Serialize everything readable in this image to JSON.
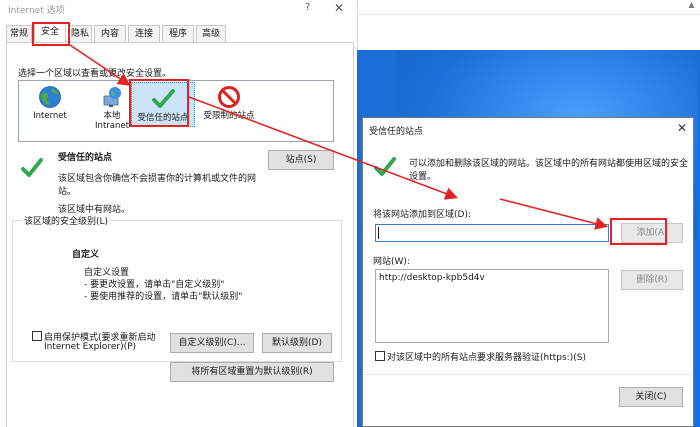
{
  "inet_dialog": {
    "title": "Internet 选项",
    "help_glyph": "?",
    "close_glyph": "✕",
    "tabs": [
      {
        "label": "常规",
        "active": false
      },
      {
        "label": "安全",
        "active": true
      },
      {
        "label": "隐私",
        "active": false
      },
      {
        "label": "内容",
        "active": false
      },
      {
        "label": "连接",
        "active": false
      },
      {
        "label": "程序",
        "active": false
      },
      {
        "label": "高级",
        "active": false
      }
    ],
    "zone_prompt": "选择一个区域以查看或更改安全设置。",
    "zones": [
      {
        "label": "Internet",
        "icon": "globe-icon"
      },
      {
        "label": "本地\nIntranet",
        "icon": "local-intranet-icon"
      },
      {
        "label": "受信任的站点",
        "icon": "checkmark-icon",
        "selected": true
      },
      {
        "label": "受限制的站点",
        "icon": "restricted-icon"
      }
    ],
    "selected_zone": {
      "title": "受信任的站点",
      "desc_line1": "该区域包含你确信不会损害你的计算机或文件的网",
      "desc_line2": "站。",
      "desc_line3": "该区域中有网站。"
    },
    "sites_button": "站点(S)",
    "security_level": {
      "legend": "该区域的安全级别(L)",
      "name": "自定义",
      "line1": "自定义设置",
      "line2": "- 要更改设置，请单击\"自定义级别\"",
      "line3": "- 要使用推荐的设置，请单击\"默认级别\""
    },
    "protected_mode": {
      "line1": "启用保护模式(要求重新启动",
      "line2": "Internet Explorer)(P)",
      "checked": false
    },
    "custom_level_button": "自定义级别(C)...",
    "default_level_button": "默认级别(D)",
    "reset_all_button": "将所有区域重置为默认级别(R)"
  },
  "trusted_dialog": {
    "title": "受信任的站点",
    "close_glyph": "✕",
    "info_line1": "可以添加和删除该区域的网站。该区域中的所有网站都使用区域的安全",
    "info_line2": "设置。",
    "add_label": "将该网站添加到区域(D):",
    "add_input_value": "",
    "add_button": "添加(A)",
    "sites_label": "网站(W):",
    "sites": [
      "http://desktop-kpb5d4v"
    ],
    "remove_button": "删除(R)",
    "https_label": "对该区域中的所有站点要求服务器验证(https:)(S)",
    "https_checked": false,
    "close_button": "关闭(C)"
  },
  "colors": {
    "highlight": "#e02424",
    "selection": "#cce4f7",
    "desktop_blue": "#1b6fd8",
    "check_green": "#2fa84f"
  }
}
